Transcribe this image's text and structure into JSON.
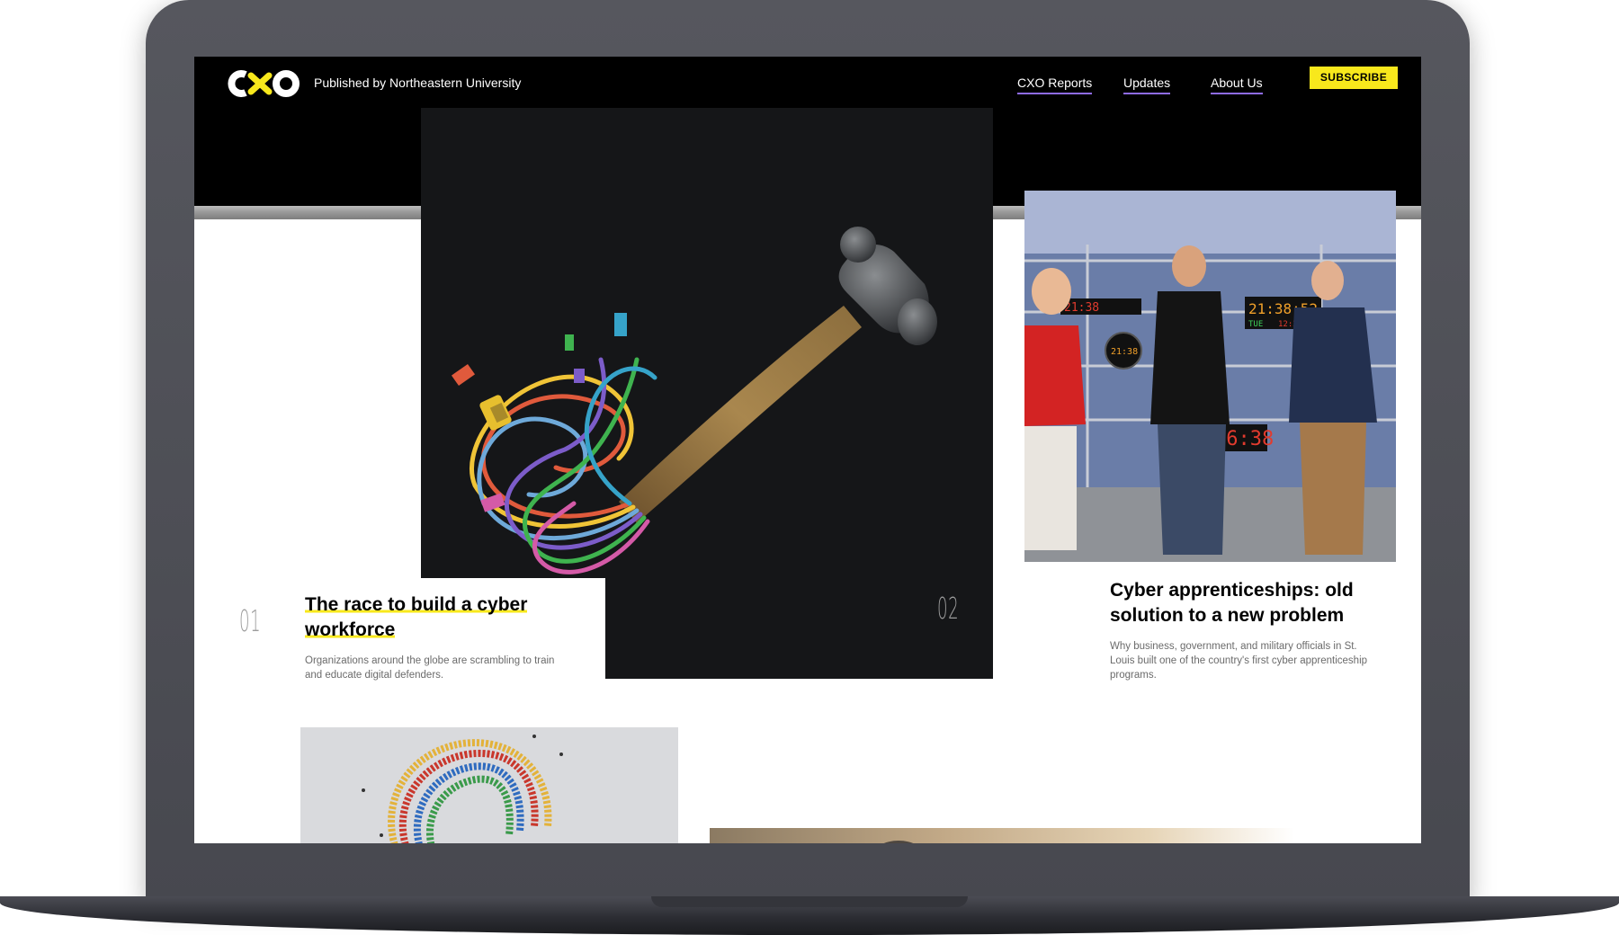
{
  "header": {
    "logo_text": "cxo",
    "published_by": "Published by Northeastern University",
    "nav": [
      {
        "label": "CXO Reports"
      },
      {
        "label": "Updates"
      },
      {
        "label": "About Us"
      }
    ],
    "subscribe_label": "SUBSCRIBE"
  },
  "articles": [
    {
      "number": "01",
      "title": "The race to build a cyber workforce",
      "description": "Organizations around the globe are scrambling to train and educate digital defenders."
    },
    {
      "number": "02",
      "title": "Cyber apprenticeships: old solution to a new problem",
      "description": "Why business, government, and military officials in St. Louis built one of the country's first cyber apprenticeship programs."
    }
  ],
  "photo_clocks": [
    "21:38",
    "21:38:52",
    "TUE",
    "12:3 18",
    "16:38"
  ],
  "colors": {
    "accent_yellow": "#f8e81c",
    "nav_underline": "#8e6bea",
    "header_bg": "#000000"
  }
}
